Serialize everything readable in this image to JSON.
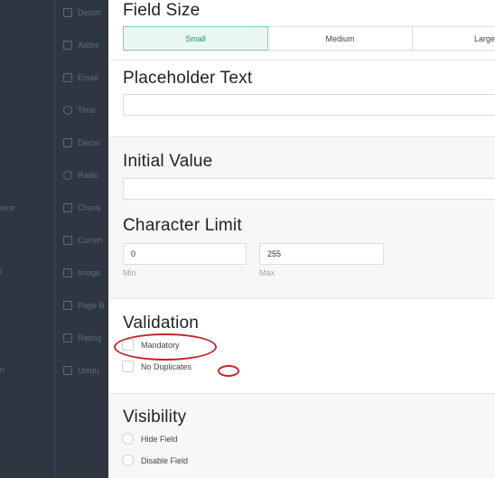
{
  "background": {
    "items": [
      {
        "label": "Decim",
        "icon": "hash-icon"
      },
      {
        "label": "Addre",
        "icon": "address-icon"
      },
      {
        "label": "Email",
        "icon": "email-icon"
      },
      {
        "label": "Time",
        "icon": "clock-icon"
      },
      {
        "label": "Decisi",
        "icon": "decision-icon"
      },
      {
        "label": "Radio",
        "icon": "radio-icon"
      },
      {
        "label": "Check",
        "icon": "checkbox-icon"
      },
      {
        "label": "Curren",
        "icon": "currency-icon"
      },
      {
        "label": "Image",
        "icon": "image-icon"
      },
      {
        "label": "Page B",
        "icon": "page-break-icon"
      },
      {
        "label": "Rating",
        "icon": "star-icon"
      },
      {
        "label": "Uniqu",
        "icon": "unique-icon"
      }
    ],
    "left_labels": [
      "oice",
      "l",
      "n"
    ]
  },
  "field_size": {
    "title": "Field Size",
    "options": [
      "Small",
      "Medium",
      "Large"
    ],
    "selected": "Small"
  },
  "placeholder": {
    "title": "Placeholder Text",
    "value": ""
  },
  "initial_value": {
    "title": "Initial Value",
    "value": ""
  },
  "char_limit": {
    "title": "Character Limit",
    "min_value": "0",
    "max_value": "255",
    "min_label": "Min",
    "max_label": "Max"
  },
  "validation": {
    "title": "Validation",
    "options": [
      "Mandatory",
      "No Duplicates"
    ]
  },
  "visibility": {
    "title": "Visibility",
    "options": [
      "Hide Field",
      "Disable Field"
    ]
  },
  "colors": {
    "accent": "#7fcab3",
    "annotation": "#c8232f",
    "overlay": "#2e3741"
  }
}
